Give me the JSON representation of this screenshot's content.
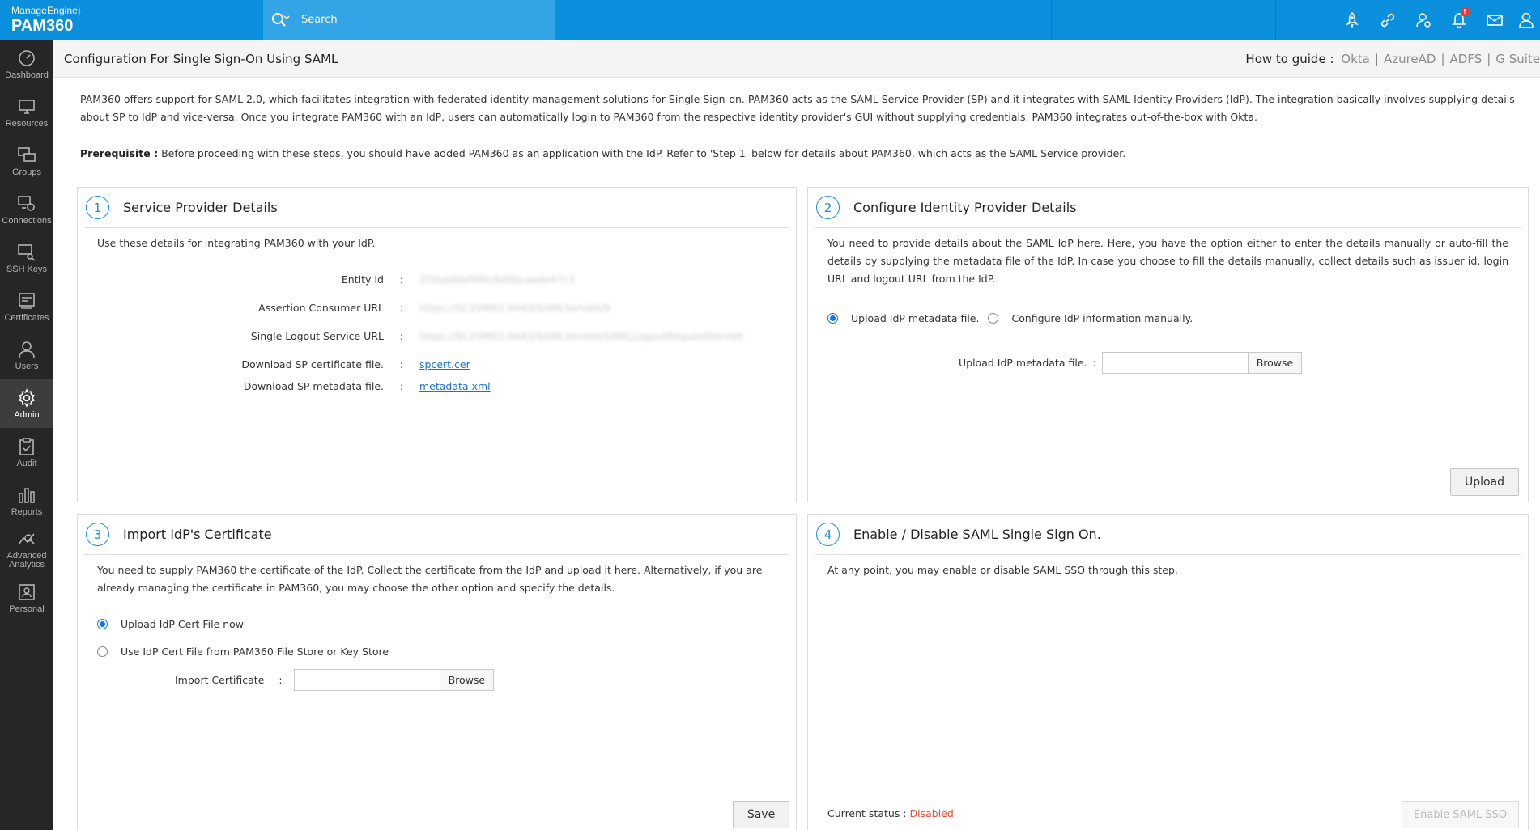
{
  "app": {
    "vendor": "ManageEngine",
    "product": "PAM360"
  },
  "search": {
    "placeholder": "Search"
  },
  "top_icons": [
    {
      "name": "rocket-icon"
    },
    {
      "name": "link-icon"
    },
    {
      "name": "user-settings-icon"
    },
    {
      "name": "bell-icon",
      "badge": "!"
    },
    {
      "name": "mail-icon"
    },
    {
      "name": "user-icon"
    }
  ],
  "sidebar": {
    "items": [
      {
        "label": "Dashboard"
      },
      {
        "label": "Resources"
      },
      {
        "label": "Groups"
      },
      {
        "label": "Connections"
      },
      {
        "label": "SSH Keys"
      },
      {
        "label": "Certificates"
      },
      {
        "label": "Users"
      },
      {
        "label": "Admin",
        "active": true
      },
      {
        "label": "Audit"
      },
      {
        "label": "Reports"
      },
      {
        "label": "Advanced Analytics"
      },
      {
        "label": "Personal"
      }
    ]
  },
  "header": {
    "title": "Configuration For Single Sign-On Using SAML",
    "howto_label": "How to guide :",
    "guides": [
      "Okta",
      "AzureAD",
      "ADFS",
      "G Suite"
    ]
  },
  "intro": {
    "text": "PAM360 offers support for SAML 2.0, which facilitates integration with federated identity management solutions for Single Sign-on. PAM360 acts as the SAML Service Provider (SP) and it integrates with SAML Identity Providers (IdP). The integration basically involves supplying details about SP to IdP and vice-versa. Once you integrate PAM360 with an IdP, users can automatically login to PAM360 from the respective identity provider's GUI without supplying credentials. PAM360 integrates out-of-the-box with Okta.",
    "prereq_label": "Prerequisite :",
    "prereq_text": "Before proceeding with these steps, you should have added PAM360 as an application with the IdP. Refer to 'Step 1' below for details about PAM360, which acts as the SAML Service provider."
  },
  "step1": {
    "num": "1",
    "title": "Service Provider Details",
    "desc": "Use these details for integrating PAM360 with your IdP.",
    "fields": [
      {
        "label": "Entity Id",
        "value": "2f1bdd0ef6f0c8d5bcaede47c3"
      },
      {
        "label": "Assertion Consumer URL",
        "value": "https://SC2VM01:9443/SAMLServlet/9"
      },
      {
        "label": "Single Logout Service URL",
        "value": "https://SC2VM01:9443/SAMLServlet/SAMLLogoutRequestServlet"
      },
      {
        "label": "Download SP certificate file.",
        "value": "spcert.cer"
      },
      {
        "label": "Download SP metadata file.",
        "value": "metadata.xml"
      }
    ]
  },
  "step2": {
    "num": "2",
    "title": "Configure Identity Provider Details",
    "desc": "You need to provide details about the SAML IdP here. Here, you have the option either to enter the details manually or auto-fill the details by supplying the metadata file of the IdP. In case you choose to fill the details manually, collect details such as issuer id, login URL and logout URL from the IdP.",
    "option_upload": "Upload IdP metadata file.",
    "option_manual": "Configure IdP information manually.",
    "upload_label": "Upload IdP metadata file.",
    "browse": "Browse",
    "upload_button": "Upload"
  },
  "step3": {
    "num": "3",
    "title": "Import IdP's Certificate",
    "desc": "You need to supply PAM360 the certificate of the IdP. Collect the certificate from the IdP and upload it here. Alternatively, if you are already managing the certificate in PAM360, you may choose the other option and specify the details.",
    "option_upload": "Upload IdP Cert File now",
    "option_store": "Use IdP Cert File from PAM360 File Store or Key Store",
    "import_label": "Import Certificate",
    "browse": "Browse",
    "save_button": "Save"
  },
  "step4": {
    "num": "4",
    "title": "Enable / Disable SAML Single Sign On.",
    "desc": "At any point, you may enable or disable SAML SSO through this step.",
    "status_label": "Current status :",
    "status_value": "Disabled",
    "enable_button": "Enable SAML SSO"
  },
  "colors": {
    "topbar": "#0a8fdc",
    "sidebar": "#262626",
    "accent": "#1c8ed6",
    "status_disabled": "#e74c3c"
  }
}
